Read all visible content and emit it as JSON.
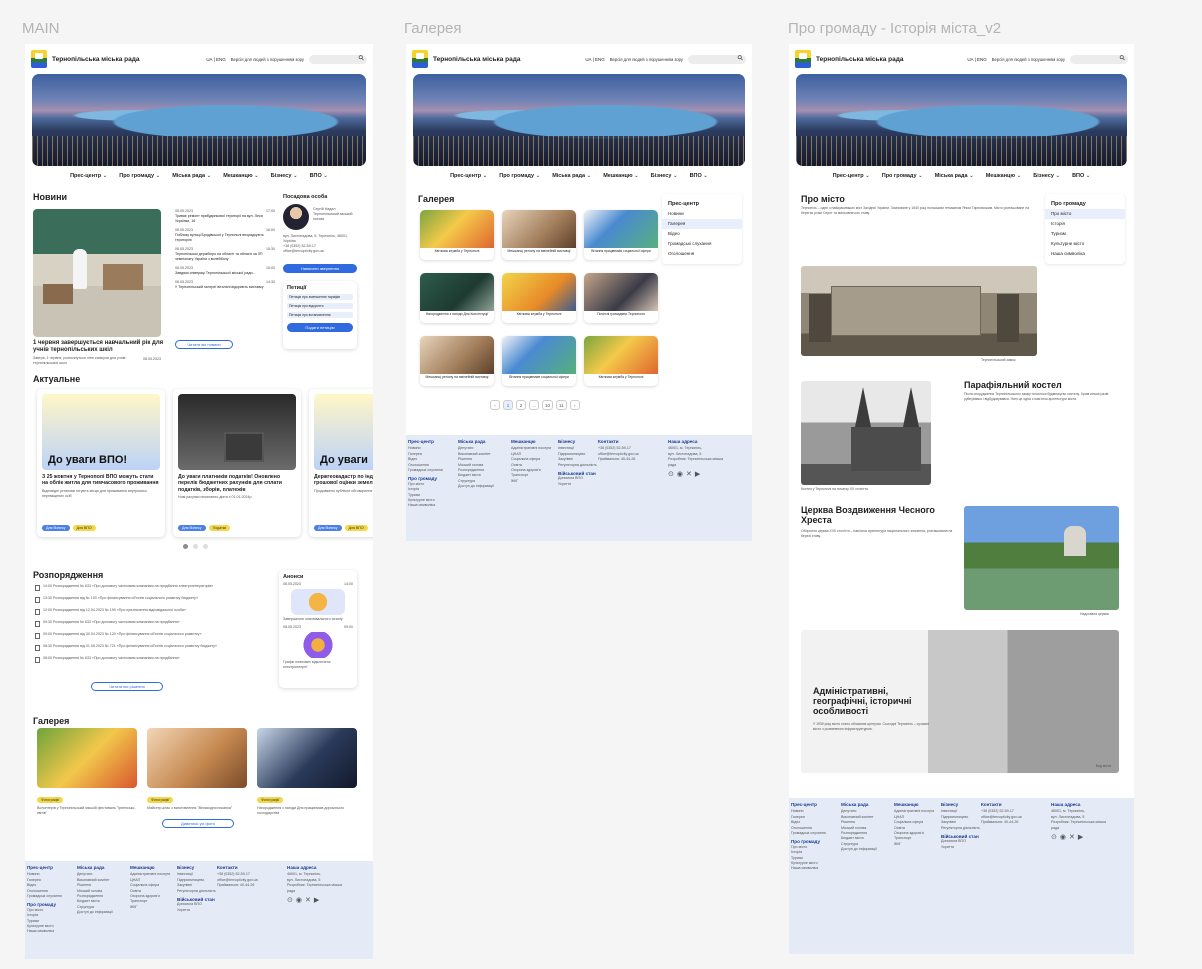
{
  "frames": {
    "main": "MAIN",
    "gallery": "Галерея",
    "history": "Про громаду - Історія міста_v2"
  },
  "header": {
    "brand": "Тернопільська міська рада",
    "lang": "UA | ENG",
    "vision": "Версія для людей з порушенням зору",
    "search_placeholder": ""
  },
  "nav": [
    "Прес-центр",
    "Про громаду",
    "Міська рада",
    "Мешканцю",
    "Бізнесу",
    "ВПО"
  ],
  "main": {
    "news_title": "Новини",
    "news_headline": "1 червня завершується навчальний рік для учнів тернопільських шкіл",
    "news_sub": "Завтра, 1 червня, розпочнуться літні канікули для учнів тернопільських шкіл",
    "news_date": "08.05.2023",
    "news_list": [
      {
        "date": "08.05.2023",
        "time": "17:00",
        "text": "Триває ремонт прибудинкової території на вул. Леся Українки, 16"
      },
      {
        "date": "08.05.2023",
        "time": "16:00",
        "text": "Поблизу вулиці Бродівської у Тернополі впорядкують територію"
      },
      {
        "date": "08.05.2023",
        "time": "15:30",
        "text": "Тернопільські держбюро на області та області за ЗП чемпіонату України з волейболу"
      },
      {
        "date": "08.05.2023",
        "time": "15:00",
        "text": "Завдяки співпраці Тернопільської міської ради..."
      },
      {
        "date": "08.05.2023",
        "time": "14:30",
        "text": "У Тернопільській галереї вітальні відкриють виставку"
      }
    ],
    "all_news": "Читати всі новини",
    "official_title": "Посадова особа",
    "official_name": "Сергій Надал",
    "official_role": "Тернопільський міський голова",
    "official_address": "вул. Листопадова, 5, Тернопіль, 46001, Україна",
    "official_phone": "+38 (0352) 52-59-17",
    "official_email": "office@ternopilcity.gov.ua",
    "official_btn": "Написати звернення",
    "petitions_title": "Петиції",
    "petitions": [
      "Петиція про зменшення тарифів",
      "Петиція про відкриття",
      "Петиція про встановлення"
    ],
    "petitions_btn": "Подати петицію",
    "actual_title": "Актуальне",
    "actual": [
      {
        "banner": "До уваги ВПО!",
        "title": "З 25 жовтня у Тернополі ВПО можуть стати на облік житла для тимчасового проживання",
        "text": "Відповідні установи готують місця для проживання внутрішньо переміщених осіб",
        "tags": [
          "Для бізнесу",
          "Для ВПО"
        ]
      },
      {
        "banner": "",
        "title": "До уваги платників податків! Оновлено перелік бюджетних рахунків для сплати податків, зборів, платежів",
        "text": "Нові рахунки починають діяти з 01.01.2024р.",
        "tags": [
          "Для бізнесу",
          "Податки"
        ]
      },
      {
        "banner": "До уваги",
        "title": "Держгеокадастр по індексацію нормативної грошової оцінки земель за 2023 рік",
        "text": "Продовжено публічне обговорення",
        "tags": [
          "Для бізнесу",
          "Для ВПО"
        ]
      }
    ],
    "orders_title": "Розпорядження",
    "orders": [
      "14:00  Розпорядження № 633 «Про допомогу частковим компаніям на придбання електрогенераторів»",
      "13:30  Розпорядження від № 100 «Про фінансування об'єктів соціального розвитку бюджету»",
      "12:00  Розпорядження від 12.04.2023 № 199 «Про призначення відповідальної особи»",
      "09:30  Розпорядження № 633 «Про допомогу частковим компаніям на придбання»",
      "09:00  Розпорядження від 30.04.2023 № 120 «Про фінансування об'єктів соціального розвитку»",
      "08:30  Розпорядження від 01.05.2023 № 721 «Про фінансування об'єктів соціального розвитку бюджету»",
      "08:00  Розпорядження № 633 «Про допомогу частковим компаніям на придбання»"
    ],
    "orders_btn": "Читати всі рішення",
    "announce_title": "Анонси",
    "announces": [
      {
        "date": "08.05.2023",
        "time": "14:00",
        "text": "Завершення опалювального сезону"
      },
      {
        "date": "08.05.2023",
        "time": "09:00",
        "text": "Графік планових відключень електроенергії"
      }
    ],
    "gallery_title": "Галерея",
    "gallery": [
      {
        "tag": "Фотографії",
        "caption": "Волонтерів у Тернопільській міській фестиваль \"Ірпенсько-квітів\""
      },
      {
        "tag": "Фотографії",
        "caption": "Майстер-клас з виготовлення \"Великодня писанка\""
      },
      {
        "tag": "Фотографії",
        "caption": "Нагородження з нагоди Дня працівників дорожнього господарства"
      }
    ],
    "gallery_btn": "Дивитись усі фото"
  },
  "gallery_page": {
    "title": "Галерея",
    "items": [
      "Квіткова клумба у Тернополі",
      "Мешканці регіону на ювілейній виставці",
      "Вітання працівників соціальної сфери",
      "Нагородження з нагоди Дня Конституції",
      "Квіткова клумба у Тернополі",
      "Почесні громадяни Тернополя",
      "Мешканці регіону на ювілейній виставці",
      "Вітання працівників соціальної сфери",
      "Квіткова клумба у Тернополі"
    ],
    "pages": [
      "‹",
      "1",
      "2",
      "...",
      "10",
      "11",
      "›"
    ],
    "sidebar_title": "Прес-центр",
    "sidebar": [
      "Новини",
      "Галерея",
      "Відео",
      "Громадські слухання",
      "Оголошення"
    ]
  },
  "history": {
    "title": "Про місто",
    "intro": "Тернопіль – одне з найкрасивіших міст Західної України. Засноване у 1540 році польським гетьманом Яном Тарновським. Місто розташоване на берегах річки Серет та мальовничого ставу.",
    "caption1": "Тернопільський замок",
    "church_title": "Парафіяльний костел",
    "church_text": "Після спорудження Тернопільського замку почалося будівництво костелу. Храм кілька разів руйнувався і відбудовувався. Нині це одна з пам'яток архітектури міста.",
    "caption2": "Костел у Тернополі на початку ХХ століття",
    "cross_title": "Церква Воздвиження Чесного Хреста",
    "cross_text": "Оборонна церква XVII століття – пам'ятка архітектури національного значення, розташована на березі ставу.",
    "caption3": "Надставна церква",
    "admin_title": "Адміністративні, географічні, історичні особливості",
    "admin_text": "У 1939 році місто стало обласним центром. Сьогодні Тернопіль – сучасне місто з розвиненою інфраструктурою.",
    "caption4": "Вид міста",
    "sidebar_title": "Про громаду",
    "sidebar": [
      "Про місто",
      "Історія",
      "Туризм",
      "Культурне місто",
      "Наша символіка"
    ]
  },
  "footer": {
    "cols": [
      {
        "title": "Прес-центр",
        "items": [
          "Новини",
          "Галерея",
          "Відео",
          "Оголошення",
          "Громадські слухання"
        ],
        "title2": "Про громаду",
        "items2": [
          "Про місто",
          "Історія",
          "Туризм",
          "Культурне місто",
          "Наша символіка"
        ]
      },
      {
        "title": "Міська рада",
        "items": [
          "Депутати",
          "Виконавчий комітет",
          "Рішення",
          "Міський голова",
          "Розпорядження",
          "Бюджет міста",
          "Структура",
          "Доступ до інформації"
        ]
      },
      {
        "title": "Мешканцю",
        "items": [
          "Адміністративні послуги",
          "ЦНАП",
          "Соціальна сфера",
          "Освіта",
          "Охорона здоров'я",
          "Транспорт",
          "ЖКГ"
        ]
      },
      {
        "title": "Бізнесу",
        "items": [
          "Інвестиції",
          "Підприємництво",
          "Закупівлі",
          "Регуляторна діяльність"
        ],
        "title2": "Військовий стан",
        "items2": [
          "Допомога ВПО",
          "Укриття"
        ]
      },
      {
        "title": "Контакти",
        "items": [
          "+38 (0352) 52-59-17",
          "office@ternopilcity.gov.ua",
          "Приймальня: 40-44-26"
        ]
      },
      {
        "title": "Наша адреса",
        "items": [
          "46001, м. Тернопіль,",
          "вул. Листопадова, 5",
          "Розробник: Тернопільська міська рада"
        ]
      }
    ]
  },
  "colors": {
    "primary": "#2f6ae0",
    "yellow": "#f5d84a",
    "footer_bg": "#e4ebf7",
    "sidebar_sel": "#e8eefb"
  }
}
